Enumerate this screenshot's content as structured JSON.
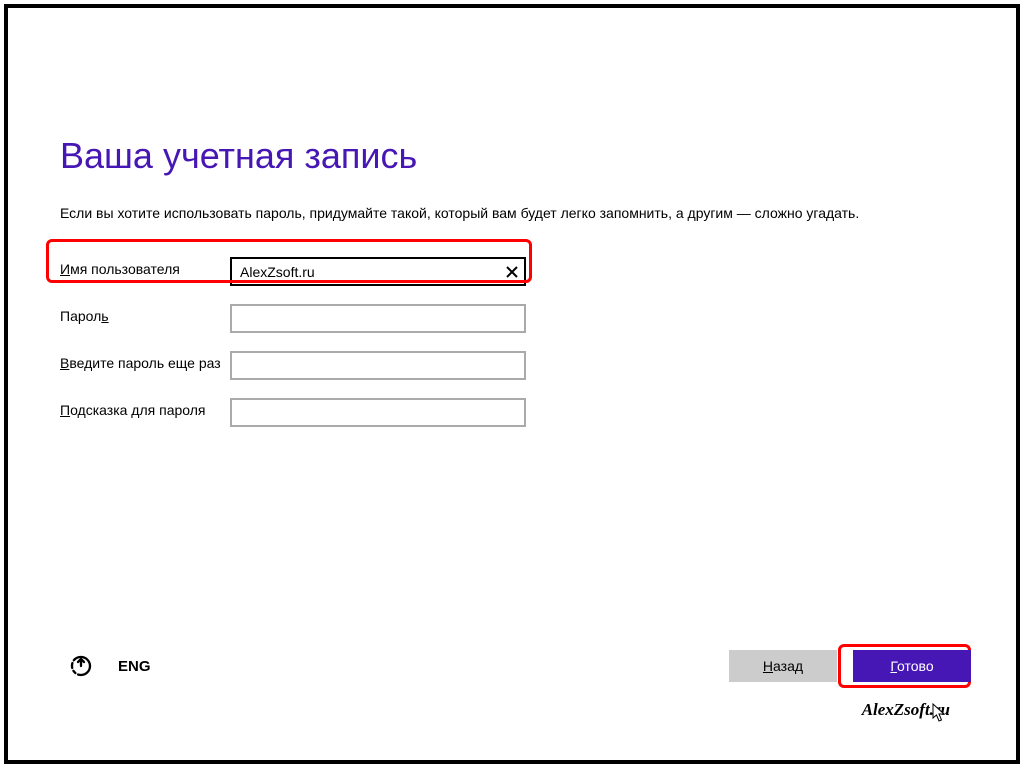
{
  "title": "Ваша учетная запись",
  "intro": "Если вы хотите использовать пароль, придумайте такой, который вам будет легко запомнить, а другим — сложно угадать.",
  "fields": {
    "username": {
      "label_pre": "И",
      "label_rest": "мя пользователя",
      "value": "AlexZsoft.ru"
    },
    "password": {
      "label_pre": "Парол",
      "label_accel": "ь",
      "label_rest": "",
      "value": ""
    },
    "password2": {
      "label_pre": "В",
      "label_rest": "ведите пароль еще раз",
      "value": ""
    },
    "hint": {
      "label_pre": "П",
      "label_rest": "одсказка для пароля",
      "value": ""
    }
  },
  "footer": {
    "language": "ENG",
    "back": {
      "accel": "Н",
      "rest": "азад"
    },
    "done": {
      "accel": "Г",
      "rest": "отово"
    }
  },
  "watermark": "AlexZsoft.ru"
}
